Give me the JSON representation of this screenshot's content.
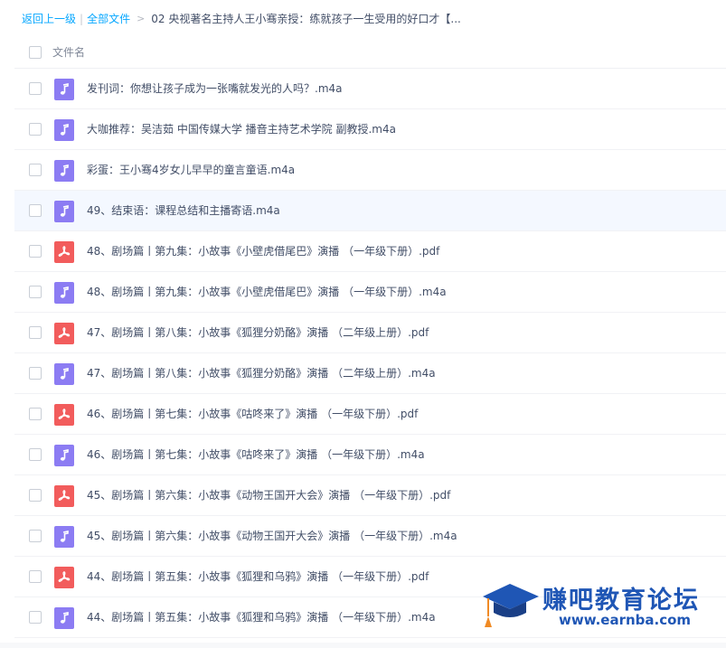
{
  "breadcrumb": {
    "back": "返回上一级",
    "separator": "|",
    "all_files": "全部文件",
    "arrow": ">",
    "current": "02 央视著名主持人王小骞亲授：练就孩子一生受用的好口才【..."
  },
  "list_header": {
    "column_name": "文件名"
  },
  "files": [
    {
      "name": "发刊词：你想让孩子成为一张嘴就发光的人吗？.m4a",
      "type": "audio"
    },
    {
      "name": "大咖推荐：吴洁茹 中国传媒大学 播音主持艺术学院 副教授.m4a",
      "type": "audio"
    },
    {
      "name": "彩蛋：王小骞4岁女儿早早的童言童语.m4a",
      "type": "audio"
    },
    {
      "name": "49、结束语：课程总结和主播寄语.m4a",
      "type": "audio"
    },
    {
      "name": "48、剧场篇丨第九集：小故事《小壁虎借尾巴》演播 （一年级下册）.pdf",
      "type": "pdf"
    },
    {
      "name": "48、剧场篇丨第九集：小故事《小壁虎借尾巴》演播 （一年级下册）.m4a",
      "type": "audio"
    },
    {
      "name": "47、剧场篇丨第八集：小故事《狐狸分奶酪》演播 （二年级上册）.pdf",
      "type": "pdf"
    },
    {
      "name": "47、剧场篇丨第八集：小故事《狐狸分奶酪》演播 （二年级上册）.m4a",
      "type": "audio"
    },
    {
      "name": "46、剧场篇丨第七集：小故事《咕咚来了》演播 （一年级下册）.pdf",
      "type": "pdf"
    },
    {
      "name": "46、剧场篇丨第七集：小故事《咕咚来了》演播 （一年级下册）.m4a",
      "type": "audio"
    },
    {
      "name": "45、剧场篇丨第六集：小故事《动物王国开大会》演播 （一年级下册）.pdf",
      "type": "pdf"
    },
    {
      "name": "45、剧场篇丨第六集：小故事《动物王国开大会》演播 （一年级下册）.m4a",
      "type": "audio"
    },
    {
      "name": "44、剧场篇丨第五集：小故事《狐狸和乌鸦》演播 （一年级下册）.pdf",
      "type": "pdf"
    },
    {
      "name": "44、剧场篇丨第五集：小故事《狐狸和乌鸦》演播 （一年级下册）.m4a",
      "type": "audio"
    }
  ],
  "watermark": {
    "title": "赚吧教育论坛",
    "url": "www.earnba.com"
  },
  "colors": {
    "link": "#06a7ff",
    "audio_icon": "#8c7cf3",
    "pdf_icon": "#f25c5c",
    "watermark": "#1f56b5"
  }
}
